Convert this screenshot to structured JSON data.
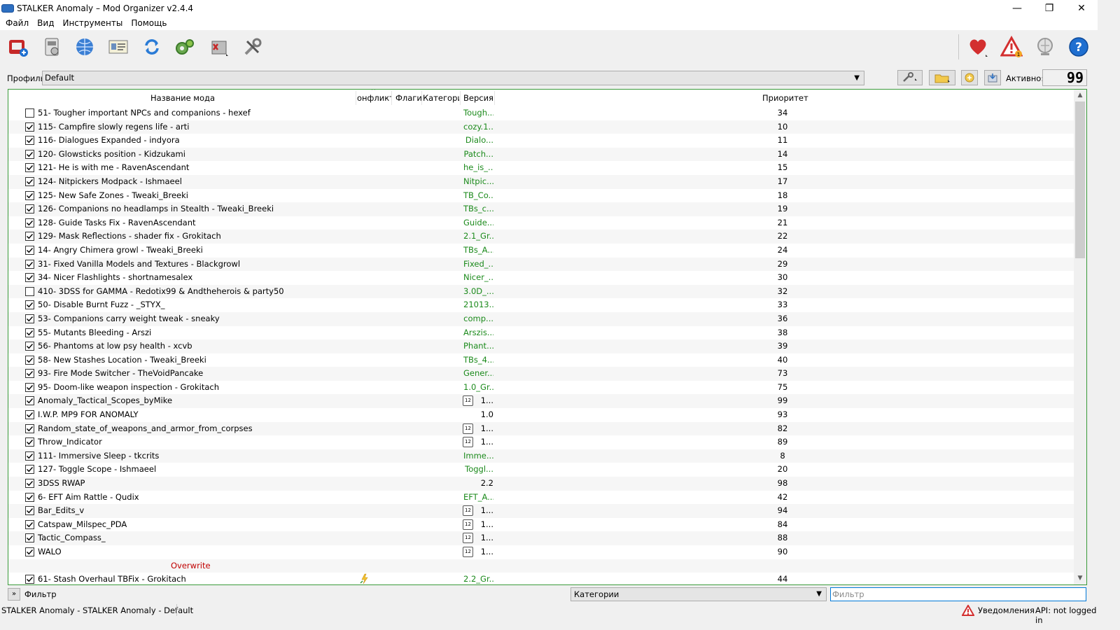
{
  "window": {
    "title": "STALKER Anomaly – Mod Organizer v2.4.4",
    "controls": {
      "minimize": "—",
      "restore": "❐",
      "close": "✕"
    }
  },
  "menu": [
    "Файл",
    "Вид",
    "Инструменты",
    "Помощь"
  ],
  "toolbar": {
    "icons": [
      "instances-icon",
      "profiles-icon",
      "nexus-browser-icon",
      "add-mod-icon",
      "refresh-icon",
      "executables-icon",
      "tools-icon",
      "settings-icon",
      "endorse-heart-icon",
      "problems-warning-icon",
      "update-icon",
      "help-icon"
    ],
    "problems_count": "1"
  },
  "profile": {
    "label": "Профиль",
    "selected": "Default",
    "active_label": "Активно:",
    "active_count": "99"
  },
  "columns": {
    "name": "Название мода",
    "conflict": "онфликт",
    "flags": "Флаги",
    "category": "Категории",
    "version": "Версия",
    "priority": "Приоритет"
  },
  "mods": [
    {
      "checked": false,
      "name": "51- Tougher important NPCs and companions - hexef",
      "version": "Tough...",
      "version_style": "green",
      "priority": "34"
    },
    {
      "checked": true,
      "name": "115- Campfire slowly regens life - arti",
      "version": "cozy.1...",
      "version_style": "green",
      "priority": "10"
    },
    {
      "checked": true,
      "name": "116- Dialogues Expanded - indyora",
      "version": "Dialo...",
      "version_style": "green",
      "priority": "11"
    },
    {
      "checked": true,
      "name": "120- Glowsticks position - Kidzukami",
      "version": "Patch...",
      "version_style": "green",
      "priority": "14"
    },
    {
      "checked": true,
      "name": "121- He is with me - RavenAscendant",
      "version": "he_is_...",
      "version_style": "green",
      "priority": "15"
    },
    {
      "checked": true,
      "name": "124- Nitpickers Modpack - Ishmaeel",
      "version": "Nitpic...",
      "version_style": "green",
      "priority": "17"
    },
    {
      "checked": true,
      "name": "125- New Safe Zones - Tweaki_Breeki",
      "version": "TB_Co...",
      "version_style": "green",
      "priority": "18"
    },
    {
      "checked": true,
      "name": "126- Companions no headlamps in Stealth - Tweaki_Breeki",
      "version": "TBs_c...",
      "version_style": "green",
      "priority": "19"
    },
    {
      "checked": true,
      "name": "128- Guide Tasks Fix - RavenAscendant",
      "version": "Guide...",
      "version_style": "green",
      "priority": "21"
    },
    {
      "checked": true,
      "name": "129- Mask Reflections - shader fix - Grokitach",
      "version": "2.1_Gr...",
      "version_style": "green",
      "priority": "22"
    },
    {
      "checked": true,
      "name": "14- Angry Chimera growl - Tweaki_Breeki",
      "version": "TBs_A...",
      "version_style": "green",
      "priority": "24"
    },
    {
      "checked": true,
      "name": "31- Fixed Vanilla Models and Textures - Blackgrowl",
      "version": "Fixed_...",
      "version_style": "green",
      "priority": "29"
    },
    {
      "checked": true,
      "name": "34- Nicer Flashlights - shortnamesalex",
      "version": "Nicer_...",
      "version_style": "green",
      "priority": "30"
    },
    {
      "checked": false,
      "name": "410- 3DSS for GAMMA - Redotix99 & Andtheherois & party50",
      "version": "3.0D_...",
      "version_style": "green",
      "priority": "32"
    },
    {
      "checked": true,
      "name": "50- Disable Burnt Fuzz - _STYX_",
      "version": "21013...",
      "version_style": "green",
      "priority": "33"
    },
    {
      "checked": true,
      "name": "53- Companions carry weight tweak - sneaky",
      "version": "comp...",
      "version_style": "green",
      "priority": "36"
    },
    {
      "checked": true,
      "name": "55- Mutants Bleeding - Arszi",
      "version": "Arszis...",
      "version_style": "green",
      "priority": "38"
    },
    {
      "checked": true,
      "name": "56- Phantoms at low psy health - xcvb",
      "version": "Phant...",
      "version_style": "green",
      "priority": "39"
    },
    {
      "checked": true,
      "name": "58- New Stashes Location - Tweaki_Breeki",
      "version": "TBs_4...",
      "version_style": "green",
      "priority": "40"
    },
    {
      "checked": true,
      "name": "93- Fire Mode Switcher - TheVoidPancake",
      "version": "Gener...",
      "version_style": "green",
      "priority": "73"
    },
    {
      "checked": true,
      "name": "95- Doom-like weapon inspection - Grokitach",
      "version": "1.0_Gr...",
      "version_style": "green",
      "priority": "75"
    },
    {
      "checked": true,
      "name": "Anomaly_Tactical_Scopes_byMike",
      "version": "1...",
      "version_style": "black",
      "date_icon": true,
      "priority": "99"
    },
    {
      "checked": true,
      "name": "I.W.P. MP9 FOR ANOMALY",
      "version": "1.0",
      "version_style": "black",
      "priority": "93"
    },
    {
      "checked": true,
      "name": "Random_state_of_weapons_and_armor_from_corpses",
      "version": "1...",
      "version_style": "black",
      "date_icon": true,
      "priority": "82"
    },
    {
      "checked": true,
      "name": "Throw_Indicator",
      "version": "1...",
      "version_style": "black",
      "date_icon": true,
      "priority": "89"
    },
    {
      "checked": true,
      "name": "111- Immersive Sleep - tkcrits",
      "version": "Imme...",
      "version_style": "green",
      "priority": "8"
    },
    {
      "checked": true,
      "name": "127- Toggle Scope - Ishmaeel",
      "version": "Toggl...",
      "version_style": "green",
      "priority": "20"
    },
    {
      "checked": true,
      "name": "3DSS RWAP",
      "version": "2.2",
      "version_style": "black",
      "priority": "98"
    },
    {
      "checked": true,
      "name": "6- EFT Aim Rattle - Qudix",
      "version": "EFT_A...",
      "version_style": "green",
      "priority": "42"
    },
    {
      "checked": true,
      "name": "Bar_Edits_v",
      "version": "1...",
      "version_style": "black",
      "date_icon": true,
      "priority": "94"
    },
    {
      "checked": true,
      "name": "Catspaw_Milspec_PDA",
      "version": "1...",
      "version_style": "black",
      "date_icon": true,
      "priority": "84"
    },
    {
      "checked": true,
      "name": "Tactic_Compass_",
      "version": "1...",
      "version_style": "black",
      "date_icon": true,
      "priority": "88"
    },
    {
      "checked": true,
      "name": "WALO",
      "version": "1...",
      "version_style": "black",
      "date_icon": true,
      "priority": "90"
    },
    {
      "overwrite": true,
      "name": "Overwrite"
    },
    {
      "checked": true,
      "name": "61- Stash Overhaul TBFix - Grokitach",
      "version": "2.2_Gr...",
      "version_style": "green",
      "flag_icon": true,
      "priority": "44"
    }
  ],
  "filter": {
    "toggle": "»",
    "label": "Фильтр",
    "categories_selected": "Категории",
    "input_placeholder": "Фильтр",
    "input_value": ""
  },
  "status": {
    "text": "STALKER Anomaly - STALKER Anomaly - Default",
    "notifications": "Уведомления",
    "api": "API: not logged in"
  },
  "colors": {
    "version_green": "#1b8a1b",
    "overwrite_red": "#c00000",
    "list_border": "#3a9a3a",
    "focus_blue": "#0078d7"
  }
}
